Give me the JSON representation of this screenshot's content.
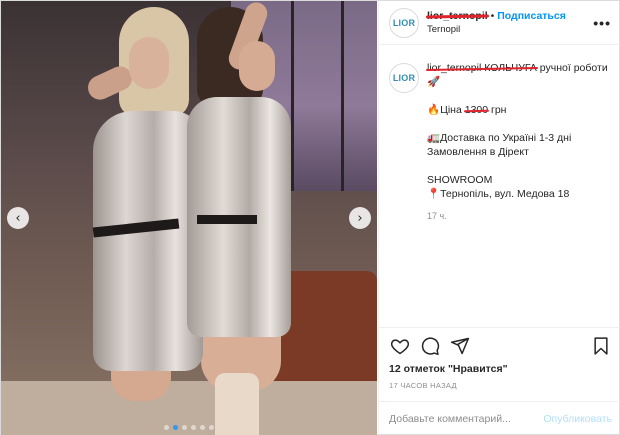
{
  "post": {
    "photo": {
      "alt": "",
      "slide_index": 2,
      "slide_count": 6
    },
    "nav": {
      "prev_icon": "‹",
      "next_icon": "›"
    },
    "header": {
      "avatar_text": "LIOR",
      "username": "lior_ternopil",
      "separator": "•",
      "follow_label": "Подписаться",
      "location": "Ternopil",
      "more_icon": "•••"
    },
    "caption": {
      "avatar_text": "LIOR",
      "username": "lior_ternopil",
      "title_struck": "КОЛЬЧУГА",
      "title_rest": " ручної роботи🚀",
      "price_prefix": "🔥Ціна ",
      "price_value": "1300",
      "price_suffix": " грн",
      "delivery": "🚛Доставка по Україні 1-3 дні",
      "order": "Замовлення в Дірект",
      "showroom": "SHOWROOM",
      "address": "📍Тернопіль, вул. Медова 18",
      "ago": "17 ч."
    },
    "likes": "12 отметок \"Нравится\"",
    "time": "17 ЧАСОВ НАЗАД",
    "comment": {
      "placeholder": "Добавьте комментарий...",
      "publish_label": "Опубликовать"
    },
    "colors": {
      "accent": "#0095f6",
      "publish_disabled": "#b2dffc",
      "scratch": "#e0242c",
      "muted": "#8e8e8e"
    },
    "icons": [
      "heart-icon",
      "comment-icon",
      "share-icon",
      "bookmark-icon"
    ]
  }
}
